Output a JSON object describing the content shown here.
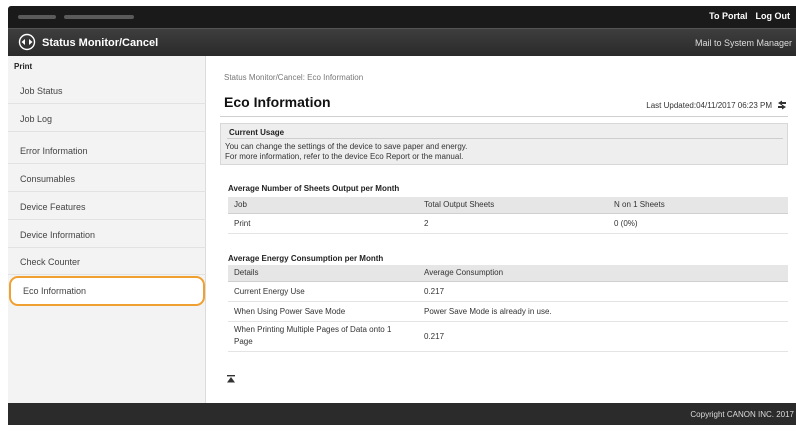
{
  "top_bar": {
    "links": [
      "To Portal",
      "Log Out"
    ]
  },
  "header": {
    "title": "Status Monitor/Cancel",
    "mail_link": "Mail to System Manager"
  },
  "sidebar": {
    "section": "Print",
    "items": [
      {
        "label": "Job Status"
      },
      {
        "label": "Job Log"
      },
      {
        "label": "Error Information"
      },
      {
        "label": "Consumables"
      },
      {
        "label": "Device Features"
      },
      {
        "label": "Device Information"
      },
      {
        "label": "Check Counter"
      },
      {
        "label": "Eco Information"
      }
    ],
    "active_item": "Eco Information",
    "highlight_color": "#f0a030"
  },
  "main": {
    "breadcrumb": "Status Monitor/Cancel: Eco Information",
    "title": "Eco Information",
    "last_updated": "Last Updated:04/11/2017 06:23 PM",
    "refresh_icon": "refresh-icon"
  },
  "current_usage": {
    "heading": "Current Usage",
    "line1": "You can change the settings of the device to save paper and energy.",
    "line2": "For more information, refer to the device Eco Report or the manual."
  },
  "sheets_table": {
    "title": "Average Number of Sheets Output per Month",
    "headers": [
      "Job",
      "Total Output Sheets",
      "N on 1 Sheets"
    ],
    "rows": [
      [
        "Print",
        "2",
        "0 (0%)"
      ]
    ]
  },
  "energy_table": {
    "title": "Average Energy Consumption per Month",
    "headers": [
      "Details",
      "Average Consumption"
    ],
    "rows": [
      [
        "Current Energy Use",
        "0.217"
      ],
      [
        "When Using Power Save Mode",
        "Power Save Mode is already in use."
      ],
      [
        "When Printing Multiple Pages of Data onto 1 Page",
        "0.217"
      ]
    ]
  },
  "footer": {
    "copyright": "Copyright CANON INC. 2017"
  }
}
